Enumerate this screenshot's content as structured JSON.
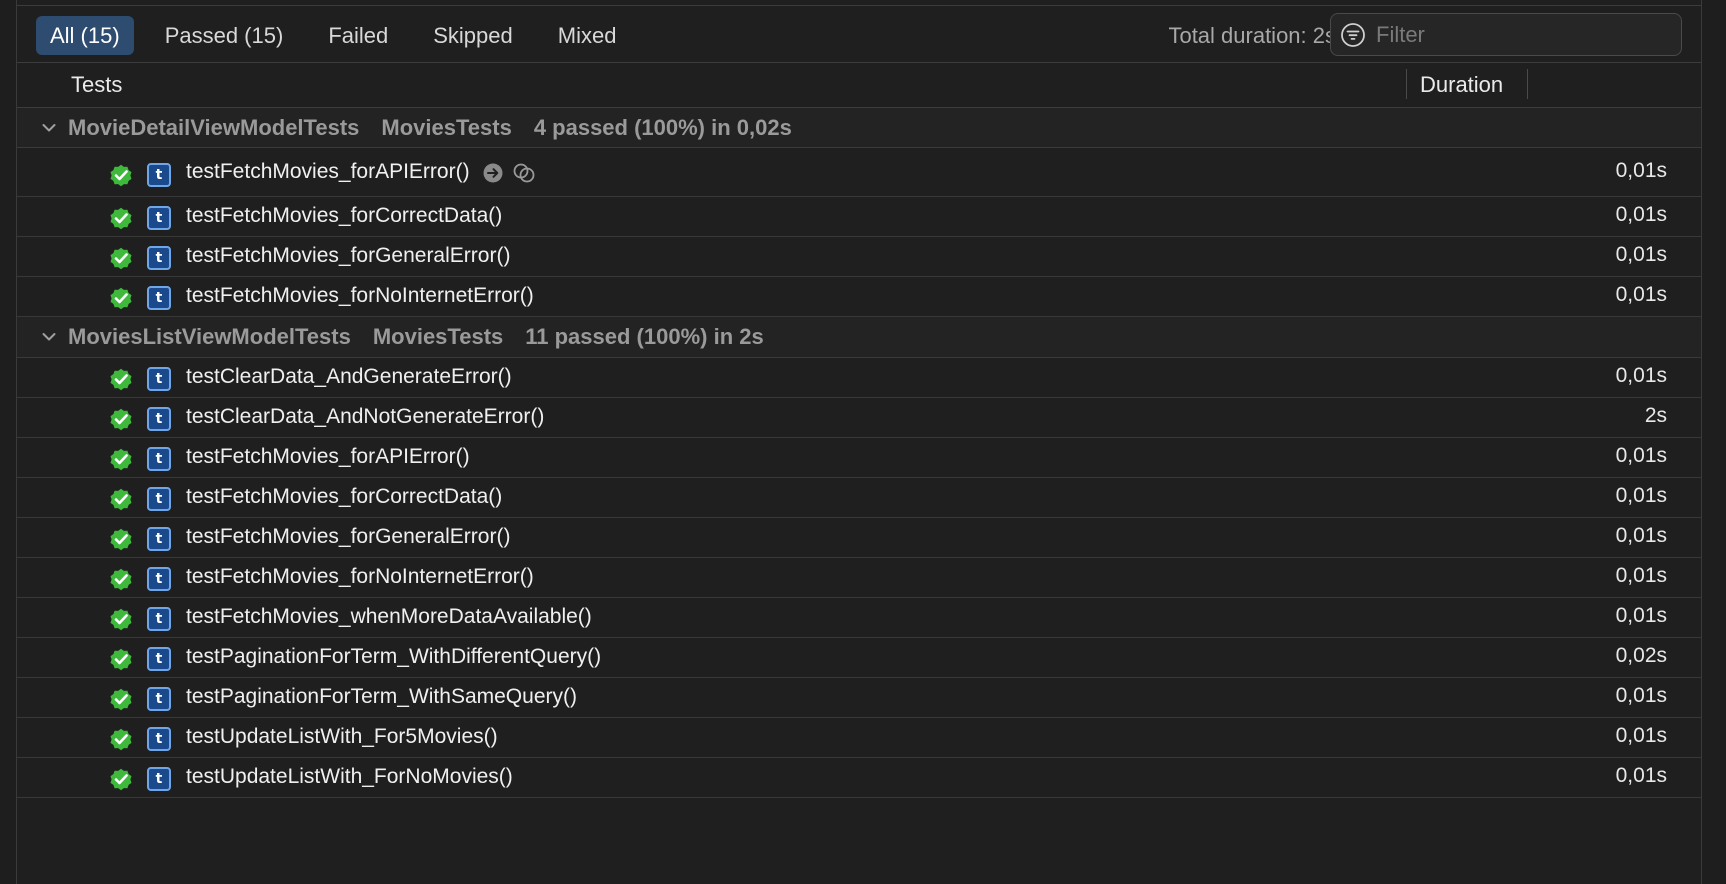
{
  "scope_tabs": [
    {
      "label": "All (15)",
      "active": true
    },
    {
      "label": "Passed (15)",
      "active": false
    },
    {
      "label": "Failed",
      "active": false
    },
    {
      "label": "Skipped",
      "active": false
    },
    {
      "label": "Mixed",
      "active": false
    }
  ],
  "total_duration": "Total duration: 2s",
  "filter": {
    "placeholder": "Filter",
    "value": ""
  },
  "columns": {
    "tests": "Tests",
    "duration": "Duration"
  },
  "colors": {
    "accent": "#2e4c6f",
    "pass_green": "#3fb93c",
    "test_badge_blue": "#1a4a8c"
  },
  "groups": [
    {
      "name": "MovieDetailViewModelTests",
      "target": "MoviesTests",
      "summary": "4 passed (100%) in 0,02s",
      "expanded": true,
      "tests": [
        {
          "name": "testFetchMovies_forAPIError()",
          "duration": "0,01s",
          "status": "passed"
        },
        {
          "name": "testFetchMovies_forCorrectData()",
          "duration": "0,01s",
          "status": "passed"
        },
        {
          "name": "testFetchMovies_forGeneralError()",
          "duration": "0,01s",
          "status": "passed"
        },
        {
          "name": "testFetchMovies_forNoInternetError()",
          "duration": "0,01s",
          "status": "passed"
        }
      ]
    },
    {
      "name": "MoviesListViewModelTests",
      "target": "MoviesTests",
      "summary": "11 passed (100%) in 2s",
      "expanded": true,
      "tests": [
        {
          "name": "testClearData_AndGenerateError()",
          "duration": "0,01s",
          "status": "passed"
        },
        {
          "name": "testClearData_AndNotGenerateError()",
          "duration": "2s",
          "status": "passed"
        },
        {
          "name": "testFetchMovies_forAPIError()",
          "duration": "0,01s",
          "status": "passed"
        },
        {
          "name": "testFetchMovies_forCorrectData()",
          "duration": "0,01s",
          "status": "passed"
        },
        {
          "name": "testFetchMovies_forGeneralError()",
          "duration": "0,01s",
          "status": "passed"
        },
        {
          "name": "testFetchMovies_forNoInternetError()",
          "duration": "0,01s",
          "status": "passed"
        },
        {
          "name": "testFetchMovies_whenMoreDataAvailable()",
          "duration": "0,01s",
          "status": "passed"
        },
        {
          "name": "testPaginationForTerm_WithDifferentQuery()",
          "duration": "0,02s",
          "status": "passed"
        },
        {
          "name": "testPaginationForTerm_WithSameQuery()",
          "duration": "0,01s",
          "status": "passed"
        },
        {
          "name": "testUpdateListWith_For5Movies()",
          "duration": "0,01s",
          "status": "passed"
        },
        {
          "name": "testUpdateListWith_ForNoMovies()",
          "duration": "0,01s",
          "status": "passed"
        }
      ]
    }
  ]
}
